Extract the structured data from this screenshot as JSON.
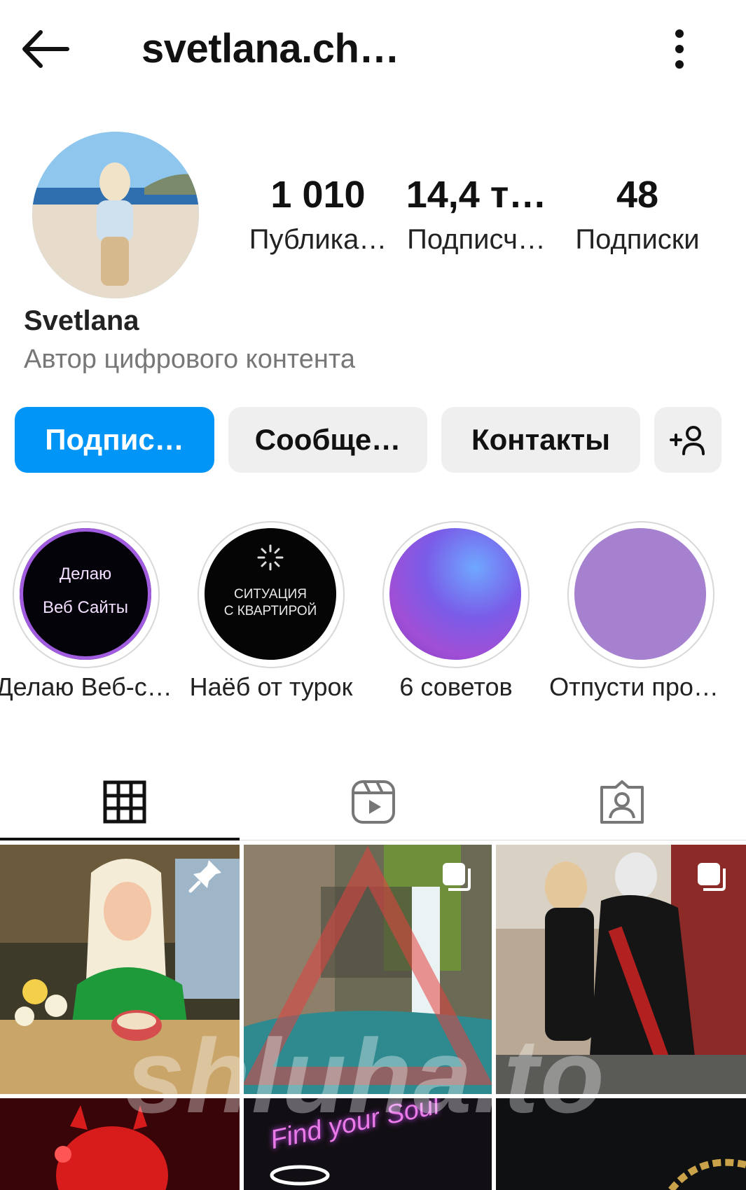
{
  "header": {
    "title": "svetlana.ch…",
    "back_icon": "arrow-left-icon",
    "more_icon": "more-vertical-icon"
  },
  "profile": {
    "name": "Svetlana",
    "category": "Автор цифрового контента",
    "stats": [
      {
        "value": "1 010",
        "label": "Публика…"
      },
      {
        "value": "14,4 т…",
        "label": "Подписч…"
      },
      {
        "value": "48",
        "label": "Подписки"
      }
    ]
  },
  "actions": {
    "follow_label": "Подпис…",
    "message_label": "Сообще…",
    "contacts_label": "Контакты",
    "add_user_icon": "add-user-icon"
  },
  "highlights": [
    {
      "label": "Делаю Веб-с…",
      "cover_text_1": "Делаю",
      "cover_text_2": "Веб Сайты"
    },
    {
      "label": "Наёб от турок",
      "cover_text_1": "СИТУАЦИЯ",
      "cover_text_2": "С КВАРТИРОЙ"
    },
    {
      "label": "6 советов"
    },
    {
      "label": "Отпусти про…"
    }
  ],
  "tabs": [
    {
      "icon": "grid-icon",
      "active": true
    },
    {
      "icon": "reels-icon",
      "active": false
    },
    {
      "icon": "tagged-icon",
      "active": false
    }
  ],
  "grid": {
    "tile5_text": "Find your Soul"
  },
  "watermark": "shluha.to",
  "colors": {
    "accent": "#0095f6",
    "button_bg": "#efefef",
    "muted_text": "#777777"
  }
}
